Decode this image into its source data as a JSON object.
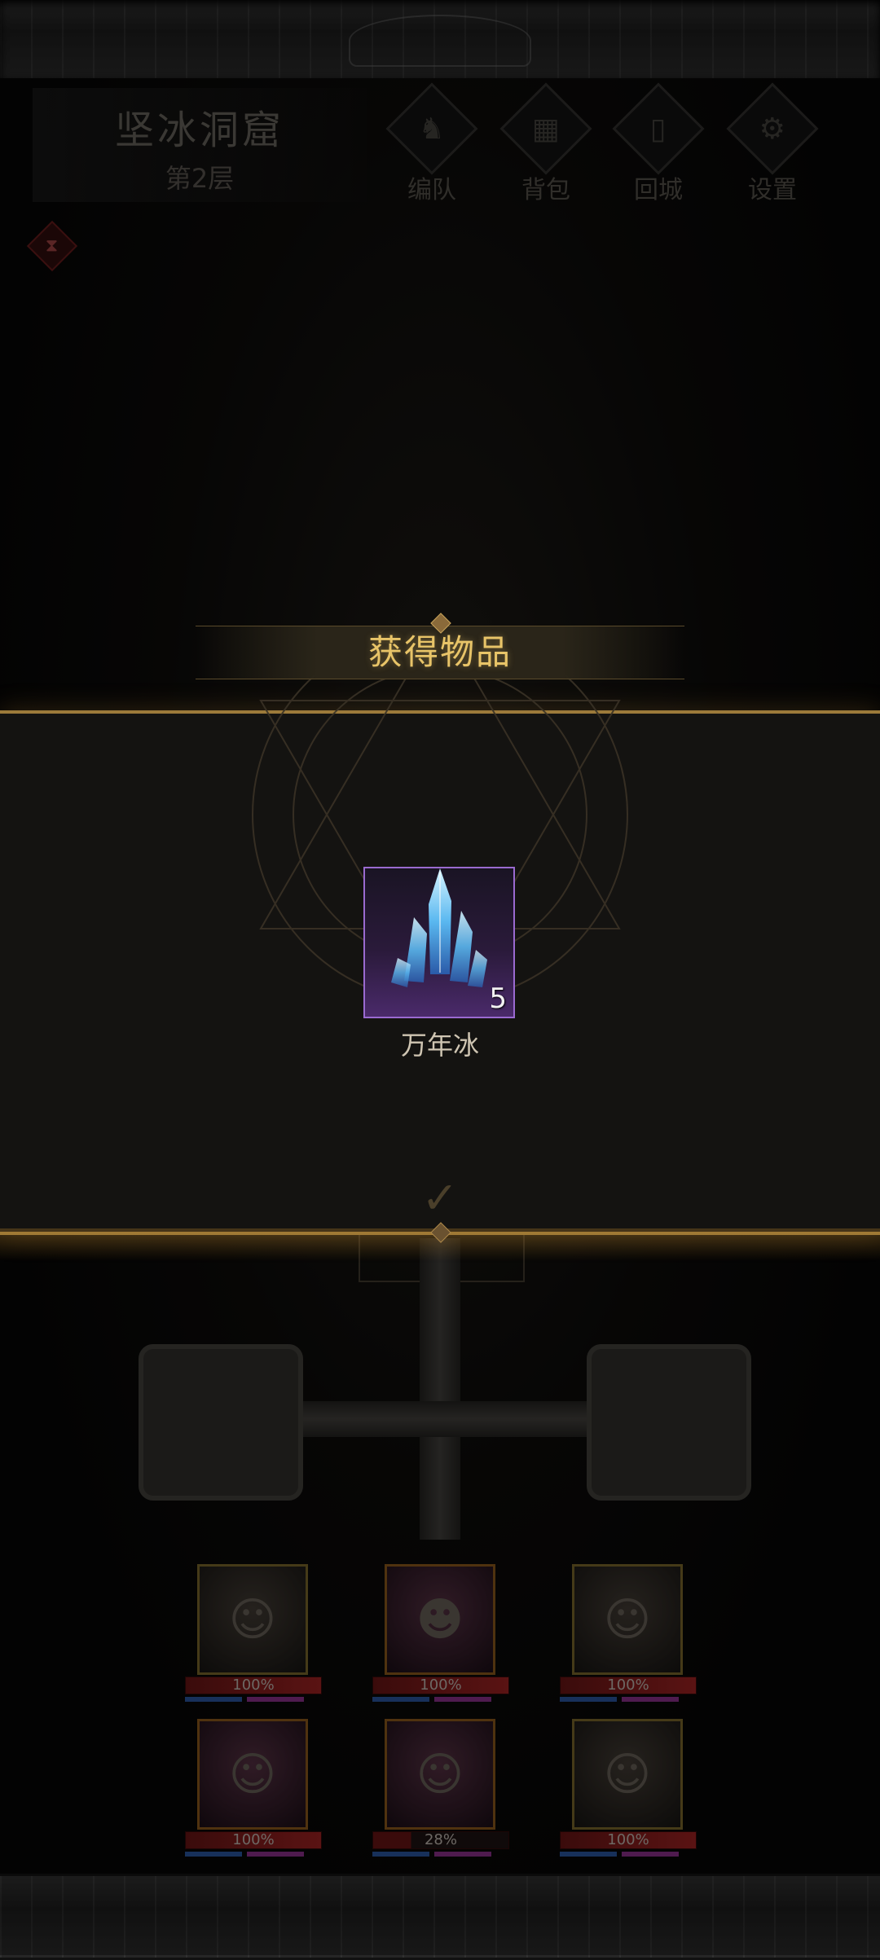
{
  "header": {
    "location_name": "坚冰洞窟",
    "floor": "第2层",
    "menu": [
      {
        "label": "编队",
        "icon": "horned-helmet-icon"
      },
      {
        "label": "背包",
        "icon": "backpack-icon"
      },
      {
        "label": "回城",
        "icon": "door-exit-icon"
      },
      {
        "label": "设置",
        "icon": "gear-icon"
      }
    ]
  },
  "reward_dialog": {
    "title": "获得物品",
    "item": {
      "name": "万年冰",
      "count": "5",
      "rarity_color": "#7a3aa8",
      "icon": "ice-crystal-icon"
    }
  },
  "party": [
    {
      "hp": "100%",
      "hp_fraction": 1.0
    },
    {
      "hp": "100%",
      "hp_fraction": 1.0
    },
    {
      "hp": "100%",
      "hp_fraction": 1.0
    },
    {
      "hp": "100%",
      "hp_fraction": 1.0
    },
    {
      "hp": "28%",
      "hp_fraction": 0.28
    },
    {
      "hp": "100%",
      "hp_fraction": 1.0
    }
  ],
  "colors": {
    "gold_accent": "#e8c468",
    "panel_border": "#9c7a3a",
    "hp_red": "#8a1e1e",
    "mp_blue": "#244a8a"
  }
}
